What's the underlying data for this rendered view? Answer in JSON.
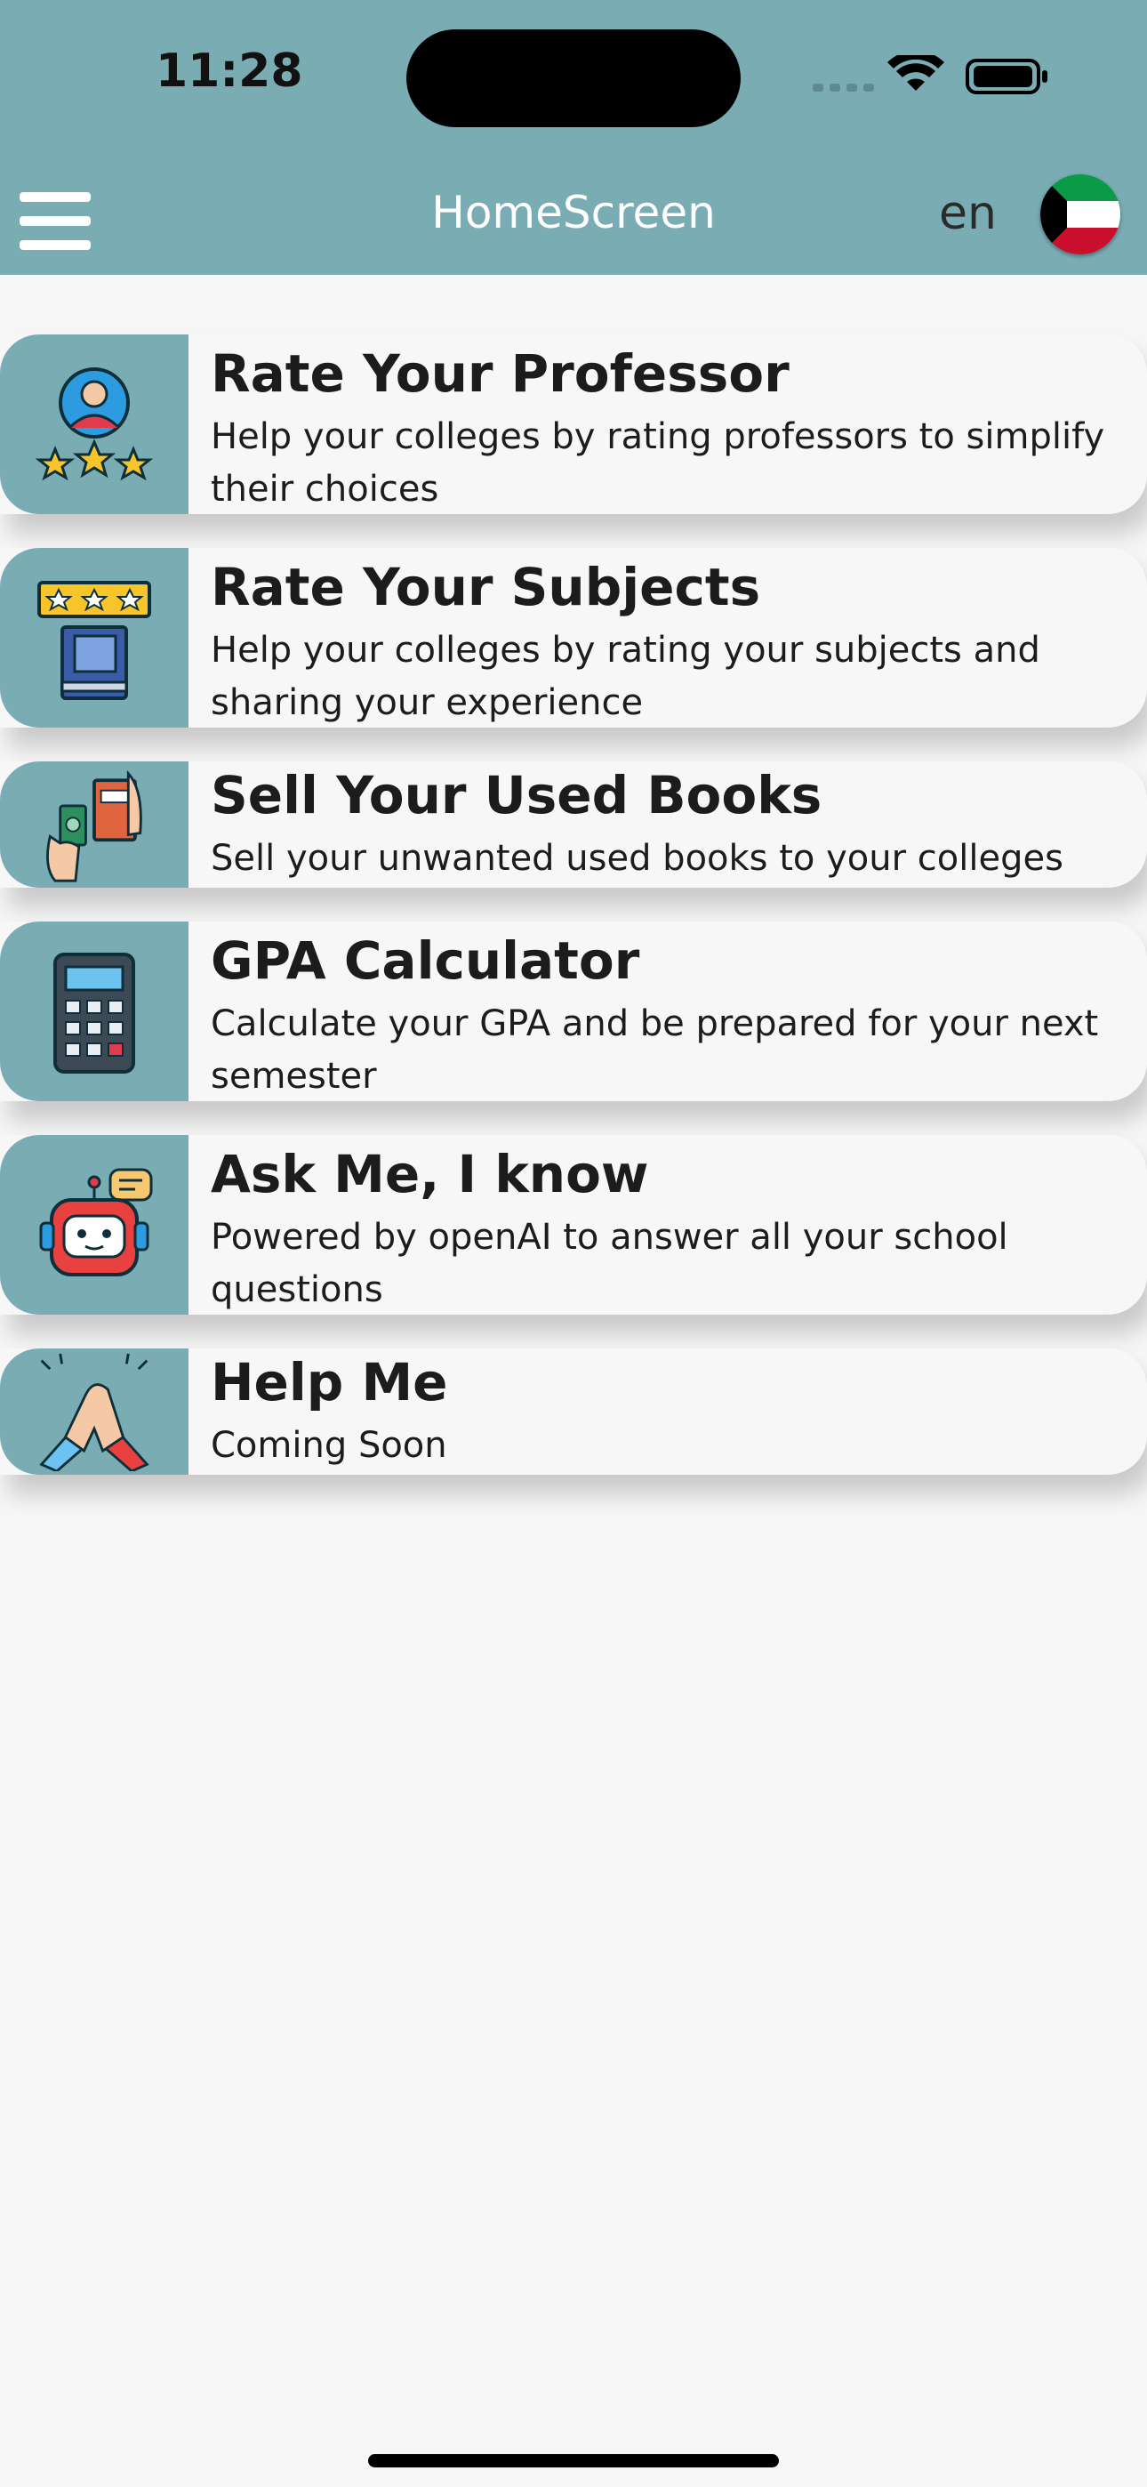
{
  "status_bar": {
    "time": "11:28"
  },
  "nav": {
    "title": "HomeScreen",
    "language": "en"
  },
  "colors": {
    "header": "#7aacb4",
    "background": "#f6f6f6",
    "card": "#f7f7f7"
  },
  "cards": [
    {
      "title": "Rate Your Professor",
      "description": "Help your colleges by rating professors to simplify their choices",
      "icon": "professor-rating-icon"
    },
    {
      "title": "Rate Your Subjects",
      "description": "Help your colleges by rating your subjects and sharing your experience",
      "icon": "book-rating-icon"
    },
    {
      "title": "Sell Your Used Books",
      "description": "Sell your unwanted used books to your colleges",
      "icon": "book-sale-icon"
    },
    {
      "title": "GPA Calculator",
      "description": "Calculate your GPA and be prepared for your next semester",
      "icon": "calculator-icon"
    },
    {
      "title": "Ask Me, I know",
      "description": "Powered by openAI to answer all your school questions",
      "icon": "robot-icon"
    },
    {
      "title": "Help Me",
      "description": "Coming Soon",
      "icon": "handshake-icon"
    }
  ]
}
